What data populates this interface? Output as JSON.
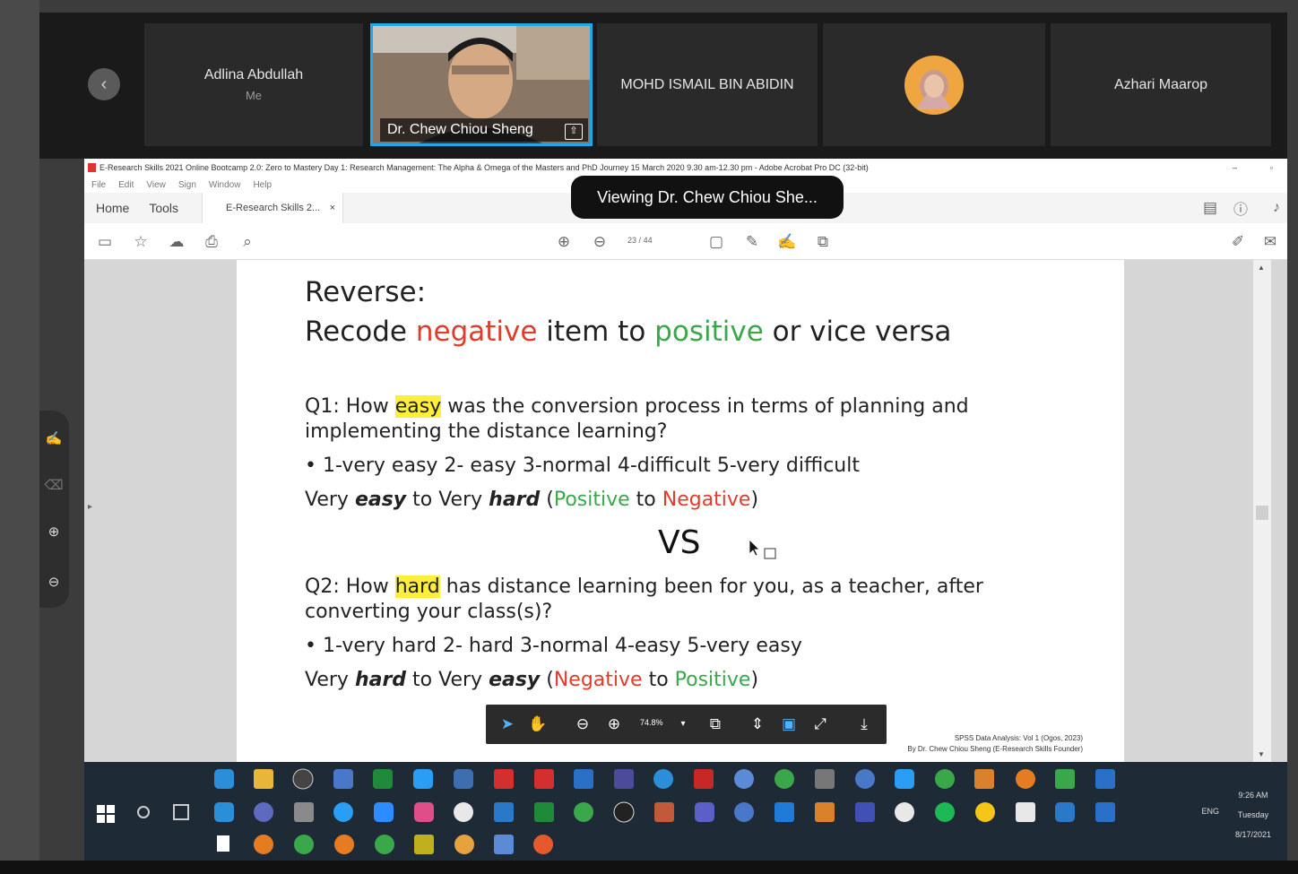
{
  "participants": [
    {
      "name": "Adlina Abdullah",
      "sub": "Me"
    },
    {
      "name": "Dr. Chew Chiou Sheng",
      "sub": ""
    },
    {
      "name": "MOHD ISMAIL BIN ABIDIN",
      "sub": ""
    },
    {
      "name": "",
      "sub": ""
    },
    {
      "name": "Azhari Maarop",
      "sub": ""
    }
  ],
  "viewing_banner": "Viewing Dr. Chew Chiou She...",
  "acrobat": {
    "window_title": "E-Research Skills 2021 Online Bootcamp 2.0: Zero to Mastery Day 1: Research Management: The Alpha & Omega of the Masters and PhD Journey 15 March 2020 9.30 am-12.30 pm - Adobe Acrobat Pro DC (32-bit)",
    "menu": [
      "File",
      "Edit",
      "View",
      "Sign",
      "Window",
      "Help"
    ],
    "tabs": {
      "home": "Home",
      "tools": "Tools",
      "doc": "E-Research Skills 2...",
      "close": "×"
    },
    "page_current": "23",
    "page_sep": "/",
    "page_total": "44",
    "zoom": "74.8%"
  },
  "slide": {
    "title1": "Reverse:",
    "t2_a": "Recode ",
    "t2_b": "negative",
    "t2_c": " item to ",
    "t2_d": "positive",
    "t2_e": " or vice versa",
    "q1_a": "Q1: How ",
    "q1_b": "easy",
    "q1_c": " was the conversion process in terms of planning and",
    "q1_d": "implementing the distance learning?",
    "q1_scale": "• 1-very easy 2- easy 3-normal 4-difficult 5-very difficult",
    "l1_a": "Very ",
    "l1_b": "easy",
    "l1_c": " to Very ",
    "l1_d": "hard",
    "l1_e": " (",
    "l1_f": "Positive",
    "l1_g": " to ",
    "l1_h": "Negative",
    "l1_i": ")",
    "vs": "VS",
    "q2_a": "Q2: How ",
    "q2_b": "hard",
    "q2_c": " has distance learning been for you, as a teacher, after",
    "q2_d": "converting your class(s)?",
    "q2_scale": "• 1-very hard 2- hard 3-normal 4-easy 5-very easy",
    "l2_a": "Very ",
    "l2_b": "hard",
    "l2_c": " to Very ",
    "l2_d": "easy",
    "l2_e": " (",
    "l2_f": "Negative",
    "l2_g": " to ",
    "l2_h": "Positive",
    "l2_i": ")",
    "footer1": "SPSS Data Analysis: Vol 1 (Ogos, 2023)",
    "footer2": "By Dr. Chew Chiou Sheng (E-Research Skills Founder)"
  },
  "clock": {
    "time": "9:26 AM",
    "day": "Tuesday",
    "date": "8/17/2021",
    "lang": "ENG"
  },
  "colors": {
    "negative": "#e03c2c",
    "positive": "#3aa84a",
    "highlight": "#ffef3a",
    "active_border": "#21a7e6"
  }
}
